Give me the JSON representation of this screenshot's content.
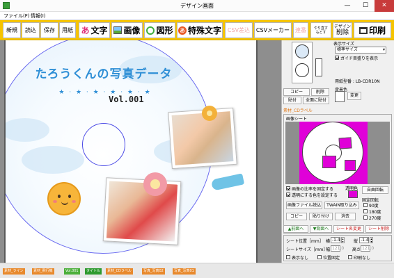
{
  "window": {
    "title": "デザイン画面",
    "min": "—",
    "max": "☐",
    "close": "✕"
  },
  "menu": [
    "ファイル(F)",
    "情報(I)"
  ],
  "toolbar": {
    "new": "新規",
    "open": "読込",
    "save": "保存",
    "paper": "用紙",
    "text_icon": "あ",
    "text": "文字",
    "image": "画像",
    "shape": "図形",
    "special_icon": "あ",
    "special": "特殊文字",
    "csv_import": "CSV差込",
    "csv_maker": "CSVメーカー",
    "continuous": "連番",
    "redo_top": "やり直す",
    "redo_bottom": "もどす",
    "design_top": "デザイン",
    "design_bottom": "削除",
    "print_icon": "☰",
    "print": "印刷"
  },
  "disc": {
    "title": "たろうくんの写真データ",
    "stars": "★ · ★ · ★ · ★ · ★ · ★",
    "volume": "Vol.001"
  },
  "panel": {
    "display_size_label": "表示サイズ",
    "display_size_value": "標準サイズ",
    "guide_label": "ガイド目盛りを表示",
    "paper_label": "用紙型番 : LB-CDR10N",
    "copy": "コピー",
    "delete": "削除",
    "paste": "貼付",
    "paste_all": "全面に貼付",
    "bg_color_label": "背景色",
    "change": "変更",
    "material_label": "素材_CDラベル",
    "sheet_label": "画像シート",
    "fix_ratio": "画像の比率を固定する",
    "transparent": "透明にする色を設定する",
    "transparent_color_label": "透明色",
    "free_rotate": "自由回転",
    "fixed_rotate": "固定回転",
    "rot_90": "90度",
    "rot_180": "180度",
    "rot_270": "270度",
    "load_image": "画像ファイル読込",
    "twain": "TWAIN取り込み",
    "copy2": "コピー",
    "paste2": "貼り付け",
    "clear": "消去",
    "front": "▲前面へ",
    "back": "▼背面へ",
    "rename_sheet": "シート名変更",
    "delete_sheet": "シート削除",
    "sheet_pos_label": "シート位置［mm］",
    "horiz": "横",
    "vert": "縦",
    "pos_x": "-1.4",
    "pos_y": "-1.4",
    "sheet_size_label": "シートサイズ［mm］",
    "width": "幅",
    "height": "高さ",
    "size_w": "121.0",
    "size_h": "121.0",
    "hidden": "表示なし",
    "pos_fixed": "位置固定",
    "no_print": "印刷なし"
  },
  "tabs": [
    {
      "label": "素材_ライン",
      "color": "#e8892c"
    },
    {
      "label": "素材_飛行機",
      "color": "#e8892c"
    },
    {
      "label": "Vol.001",
      "color": "#4caf3a"
    },
    {
      "label": "タイトル",
      "color": "#2e9a2e"
    },
    {
      "label": "素材_CDラベル",
      "color": "#e8892c"
    },
    {
      "label": "写真_写真02",
      "color": "#e8892c"
    },
    {
      "label": "写真_写真01",
      "color": "#e8892c"
    }
  ],
  "colors": {
    "toolbar": "#f6c400",
    "magenta": "#e000d8",
    "disc_text": "#2f8fd6",
    "material_label": "#e07a1a"
  }
}
